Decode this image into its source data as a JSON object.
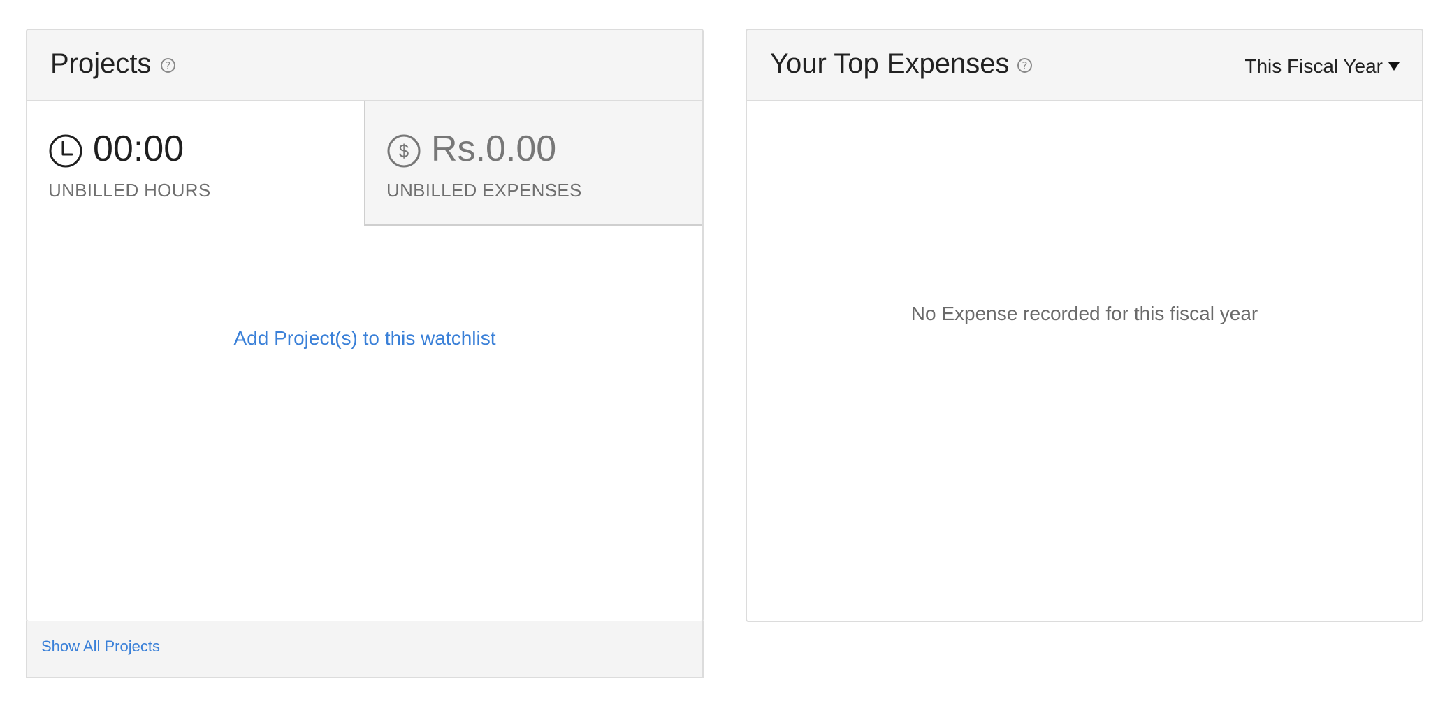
{
  "projects": {
    "title": "Projects",
    "help_icon": "question-circle-icon",
    "unbilled_hours": {
      "icon": "clock-icon",
      "value": "00:00",
      "label": "UNBILLED HOURS"
    },
    "unbilled_expenses": {
      "icon": "dollar-circle-icon",
      "value": "Rs.0.00",
      "label": "UNBILLED EXPENSES"
    },
    "add_link": "Add Project(s) to this watchlist",
    "show_all": "Show All Projects"
  },
  "expenses": {
    "title": "Your Top Expenses",
    "help_icon": "question-circle-icon",
    "period_selected": "This Fiscal Year",
    "empty_message": "No Expense recorded for this fiscal year"
  },
  "colors": {
    "link": "#3a80d8",
    "header_bg": "#f5f5f5",
    "border": "#dcdcdc"
  }
}
